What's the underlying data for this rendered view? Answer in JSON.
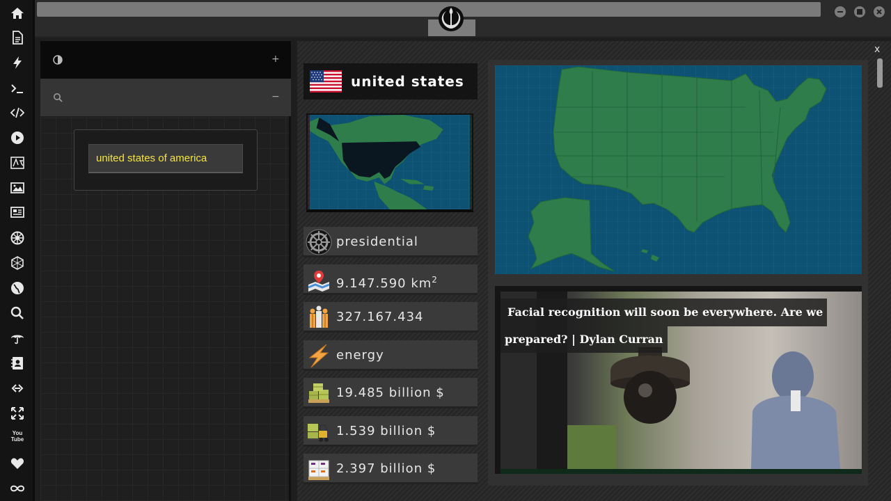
{
  "rail_icons": [
    "home-icon",
    "document-icon",
    "bolt-icon",
    "terminal-icon",
    "code-icon",
    "play-icon",
    "translate-icon",
    "image-icon",
    "newspaper-icon",
    "empire-icon",
    "hexagon-icon",
    "globe-icon",
    "search-icon",
    "umbrella-icon",
    "contacts-icon",
    "link-icon",
    "expand-icon",
    "youtube-icon",
    "heart-icon",
    "infinity-icon"
  ],
  "youtube_label": "You Tube",
  "sidebar": {
    "search_value": "united states of america",
    "row1_plus": "+",
    "row2_minus": "−"
  },
  "country": {
    "name": "united states",
    "government": "presidential",
    "area": "9.147.590 km",
    "area_unit_sup": "2",
    "population": "327.167.434",
    "sector": "energy",
    "imports": "19.485 billion $",
    "exports": "1.539 billion $",
    "third_value": "2.397 billion $"
  },
  "video": {
    "caption_line1": "Facial recognition will soon be everywhere. Are we",
    "caption_line2": "prepared? | Dylan Curran"
  },
  "close_label": "x",
  "colors": {
    "map_water": "#0d5173",
    "map_land": "#2e7d4a",
    "search_text": "#f5e542",
    "us_highlight": "#0a1620"
  }
}
